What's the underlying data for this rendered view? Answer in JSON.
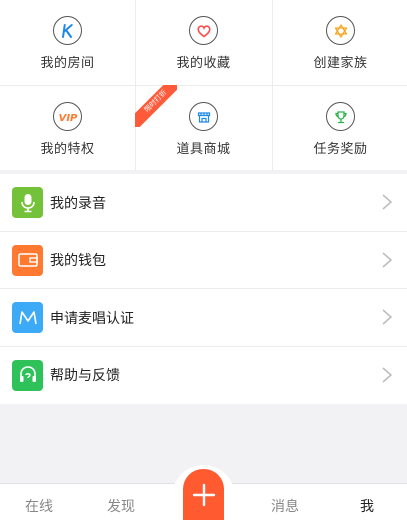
{
  "grid": {
    "items": [
      {
        "label": "我的房间",
        "icon": "k-room-icon",
        "color": "#1e88e5"
      },
      {
        "label": "我的收藏",
        "icon": "heart-icon",
        "color": "#ff4d4d"
      },
      {
        "label": "创建家族",
        "icon": "star-of-david-icon",
        "color": "#f5a623"
      },
      {
        "label": "我的特权",
        "icon": "vip-icon",
        "color": "#ff7a2e"
      },
      {
        "label": "道具商城",
        "icon": "shop-icon",
        "color": "#1e88e5"
      },
      {
        "label": "任务奖励",
        "icon": "trophy-icon",
        "color": "#2bb34a"
      }
    ],
    "ribbon_text": "限时打折"
  },
  "list": {
    "items": [
      {
        "label": "我的录音",
        "icon": "microphone-icon",
        "color": "#74c23a"
      },
      {
        "label": "我的钱包",
        "icon": "wallet-icon",
        "color": "#ff7a30"
      },
      {
        "label": "申请麦唱认证",
        "icon": "m-certification-icon",
        "color": "#3daaf7"
      },
      {
        "label": "帮助与反馈",
        "icon": "headset-icon",
        "color": "#2fc25b"
      }
    ]
  },
  "tabbar": {
    "tabs": [
      {
        "label": "在线",
        "active": false
      },
      {
        "label": "发现",
        "active": false
      },
      {
        "label": "消息",
        "active": false
      },
      {
        "label": "我",
        "active": true
      }
    ],
    "accent": "#ff5a30"
  }
}
